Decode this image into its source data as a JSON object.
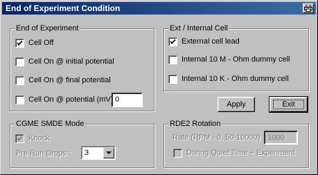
{
  "window": {
    "title": "End of Experiment Condition"
  },
  "end_of_experiment": {
    "legend": "End of Experiment",
    "options": [
      {
        "label": "Cell Off",
        "checked": true
      },
      {
        "label": "Cell On @ initial potential",
        "checked": false
      },
      {
        "label": "Cell On @ final potential",
        "checked": false
      },
      {
        "label": "Cell On @ potential (mV)",
        "checked": false
      }
    ],
    "potential_value": "0"
  },
  "ext_internal_cell": {
    "legend": "Ext / Internal Cell",
    "options": [
      {
        "label": "External cell lead",
        "checked": true
      },
      {
        "label": "Internal 10 M - Ohm dummy cell",
        "checked": false
      },
      {
        "label": "Internal 10 K - Ohm dummy cell",
        "checked": false
      }
    ]
  },
  "buttons": {
    "apply": "Apply",
    "exit": "Exit"
  },
  "cgme_smde": {
    "legend": "CGME SMDE Mode",
    "knock_label": "Knock",
    "knock_checked": true,
    "pre_run_label": "Pre Run Drops :",
    "pre_run_value": "3"
  },
  "rde2_rotation": {
    "legend": "RDE2 Rotation",
    "rate_label": "Rate (RPM - 0, 50-10000)",
    "rate_value": "1000",
    "quiet_time_label": "During Quiet Time + Experiment",
    "quiet_time_checked": false
  },
  "icons": {
    "title_button": "printer-icon",
    "checkmark": "checkmark-icon",
    "dropdown": "chevron-down-icon"
  }
}
